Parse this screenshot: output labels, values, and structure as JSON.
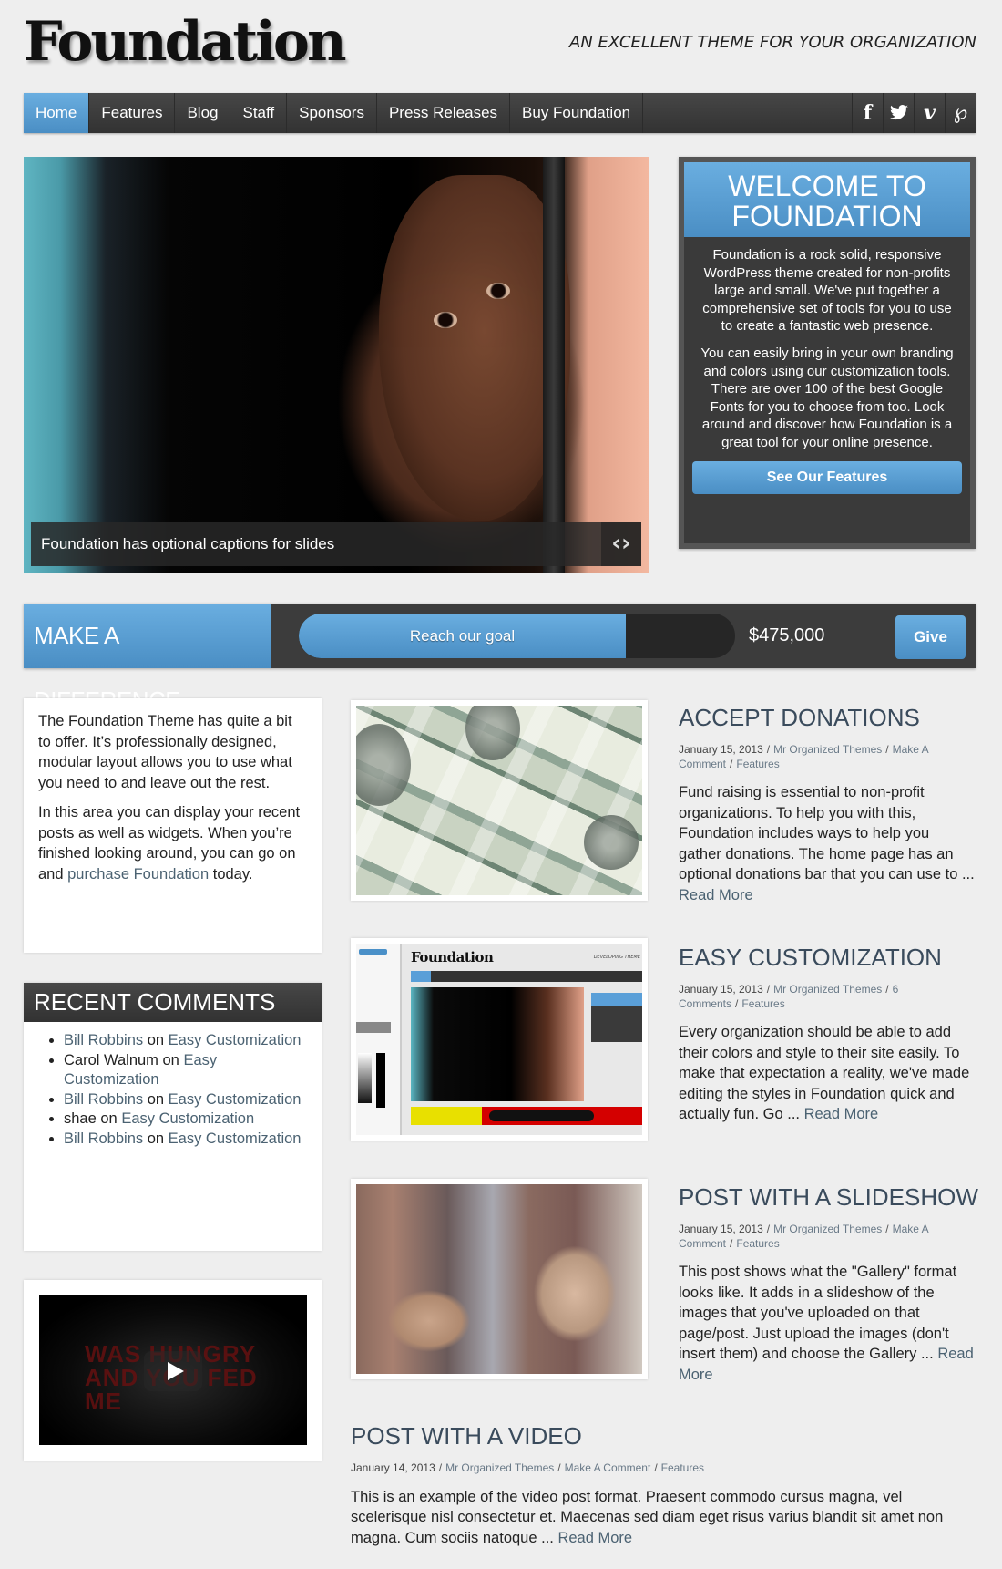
{
  "site": {
    "logo": "Foundation",
    "tagline": "AN EXCELLENT THEME FOR YOUR ORGANIZATION"
  },
  "nav": {
    "items": [
      {
        "label": "Home",
        "active": true
      },
      {
        "label": "Features"
      },
      {
        "label": "Blog"
      },
      {
        "label": "Staff"
      },
      {
        "label": "Sponsors"
      },
      {
        "label": "Press Releases"
      },
      {
        "label": "Buy Foundation"
      }
    ],
    "social": [
      {
        "name": "facebook-icon",
        "glyph": "f"
      },
      {
        "name": "twitter-icon",
        "glyph": "🐦"
      },
      {
        "name": "vimeo-icon",
        "glyph": "v"
      },
      {
        "name": "pinterest-icon",
        "glyph": "P"
      }
    ]
  },
  "hero": {
    "caption": "Foundation has optional captions for slides",
    "arrows": "‹›"
  },
  "welcome": {
    "title": "WELCOME TO FOUNDATION",
    "paragraphs": [
      "Foundation is a rock solid, responsive WordPress theme created for non-profits large and small. We've put together a comprehensive set of tools for you to use to create a fantastic web presence.",
      "You can easily bring in your own branding and colors using our customization tools. There are over 100 of the best Google Fonts for you to choose from too. Look around and discover how Foundation is a great tool for your online presence."
    ],
    "button": "See Our Features"
  },
  "donation": {
    "title": "MAKE A DIFFERENCE",
    "progress_label": "Reach our goal",
    "progress_percent": 75,
    "goal": "$475,000",
    "button": "Give"
  },
  "intro": {
    "p1": "The Foundation Theme has quite a bit to offer. It’s professionally designed, modular layout allows you to use what you need to and leave out the rest.",
    "p2_before": "In this area you can display your recent posts as well as widgets. When you’re finished looking around, you can go on and ",
    "p2_link": "purchase Foundation",
    "p2_after": " today."
  },
  "recent_comments": {
    "title": "RECENT COMMENTS",
    "items": [
      {
        "author": "Bill Robbins",
        "author_link": true,
        "on": " on ",
        "post": "Easy Customization"
      },
      {
        "author": "Carol Walnum",
        "author_link": false,
        "on": " on ",
        "post": "Easy Customization"
      },
      {
        "author": "Bill Robbins",
        "author_link": true,
        "on": " on ",
        "post": "Easy Customization"
      },
      {
        "author": "shae",
        "author_link": false,
        "on": " on ",
        "post": "Easy Customization"
      },
      {
        "author": "Bill Robbins",
        "author_link": true,
        "on": " on ",
        "post": "Easy Customization"
      }
    ]
  },
  "video_widget": {
    "overlay_text": "WAS HUNGRY AND YOU FED ME"
  },
  "posts": [
    {
      "title": "ACCEPT DONATIONS",
      "date": "January 15, 2013",
      "author": "Mr Organized Themes",
      "comments": "Make A Comment",
      "category": "Features",
      "excerpt": "Fund raising is essential to non-profit organizations. To help you with this, Foundation includes ways to help you gather donations. The home page has an optional donations bar that you can use to ... ",
      "read_more": "Read More"
    },
    {
      "title": "EASY CUSTOMIZATION",
      "date": "January 15, 2013",
      "author": "Mr Organized Themes",
      "comments": "6 Comments",
      "category": "Features",
      "excerpt": "Every organization should be able to add their colors and style to their site easily. To make that expectation a reality, we've made editing the styles in Foundation quick and actually fun. Go ... ",
      "read_more": "Read More"
    },
    {
      "title": "POST WITH A SLIDESHOW",
      "date": "January 15, 2013",
      "author": "Mr Organized Themes",
      "comments": "Make A Comment",
      "category": "Features",
      "excerpt": "This post shows what the \"Gallery\" format looks like. It adds in a slideshow of the images that you've uploaded on that page/post. Just upload the images (don't insert them) and choose the Gallery ... ",
      "read_more": "Read More"
    },
    {
      "title": "POST WITH A VIDEO",
      "date": "January 14, 2013",
      "author": "Mr Organized Themes",
      "comments": "Make A Comment",
      "category": "Features",
      "excerpt": "This is an example of the video post format. Praesent commodo cursus magna, vel scelerisque nisl consectetur et. Maecenas sed diam eget risus varius blandit sit amet non magna. Cum sociis natoque ... ",
      "read_more": "Read More"
    }
  ],
  "thumbnail_screenshot": {
    "logo": "Foundation",
    "tagline": "DEVELOPING THEME"
  },
  "colors": {
    "accent_blue": "#5a9fd8",
    "dark": "#3a3a3a",
    "heading": "#3a4b5c",
    "link": "#4b6272"
  }
}
